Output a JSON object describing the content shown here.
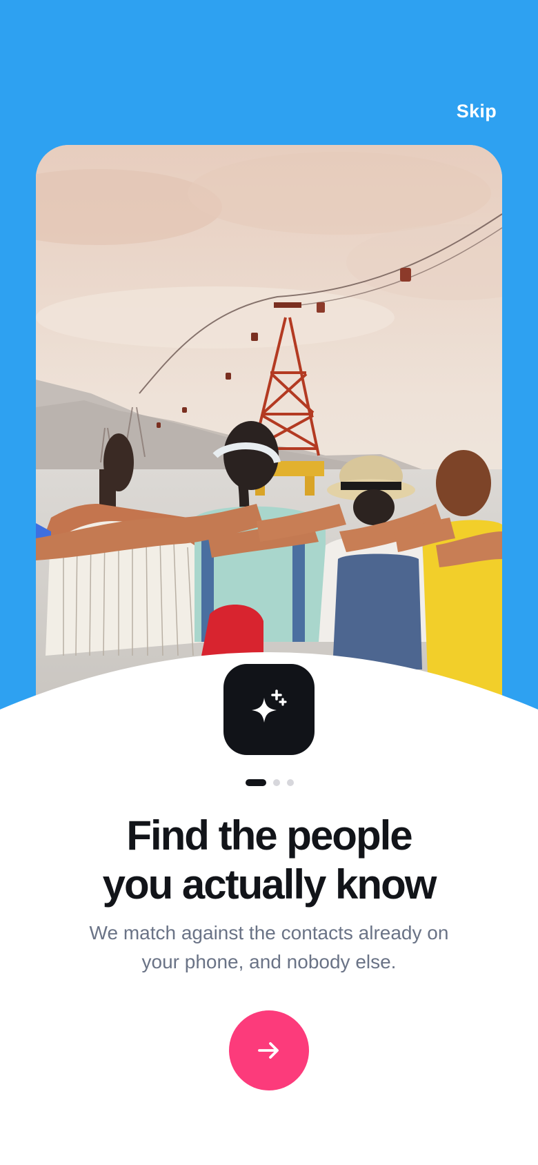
{
  "header": {
    "skip_label": "Skip"
  },
  "hero": {
    "image_alt": "Group of friends with arms around each other looking at a cable car tower by the sea"
  },
  "feature": {
    "icon": "sparkles-icon"
  },
  "pagination": {
    "total": 3,
    "active_index": 0
  },
  "content": {
    "title_line1": "Find the people",
    "title_line2": "you actually know",
    "subtitle_line1": "We match against the contacts already on",
    "subtitle_line2": "your phone, and nobody else."
  },
  "actions": {
    "next_icon": "arrow-right-icon"
  },
  "colors": {
    "background_top": "#2EA1F1",
    "accent": "#FC3B7B",
    "title": "#121419",
    "subtitle": "#6A7386",
    "icon_tile": "#111318"
  }
}
